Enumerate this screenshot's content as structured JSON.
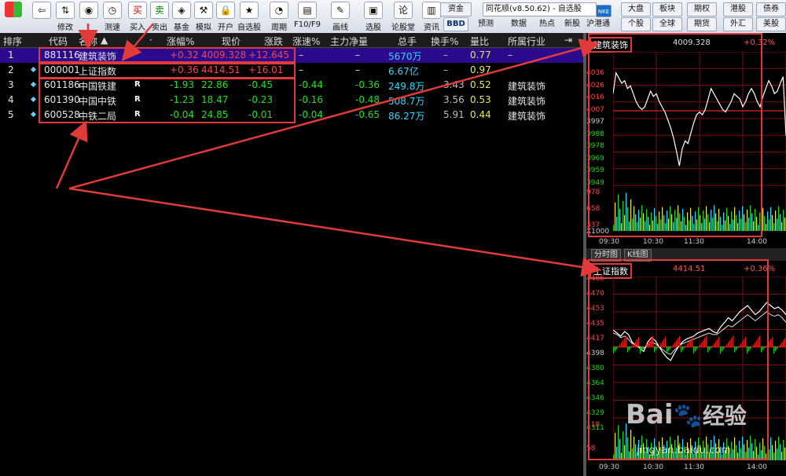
{
  "toolbar": {
    "buttons": [
      {
        "label": "",
        "icon": "grid-icon"
      },
      {
        "label": "",
        "icon": "back-arrow-icon"
      },
      {
        "label": "修改",
        "icon": "up-down-arrows-icon"
      },
      {
        "label": "",
        "icon": "coin-icon"
      },
      {
        "label": "测速",
        "icon": "clock-icon"
      },
      {
        "label": "买入",
        "icon": "buy-icon"
      },
      {
        "label": "卖出",
        "icon": "sell-icon"
      },
      {
        "label": "基金",
        "icon": "fund-icon"
      },
      {
        "label": "模拟",
        "icon": "hammer-icon"
      },
      {
        "label": "开户",
        "icon": "lock-icon"
      },
      {
        "label": "自选股",
        "icon": "star-icon"
      },
      {
        "label": "周期",
        "icon": "cycle-icon"
      },
      {
        "label": "F10/F9",
        "icon": "f10-icon"
      },
      {
        "label": "画线",
        "icon": "pen-icon"
      },
      {
        "label": "选股",
        "icon": "screen-icon"
      },
      {
        "label": "论股堂",
        "icon": "forum-icon"
      },
      {
        "label": "资讯",
        "icon": "news-icon"
      }
    ],
    "zijin": "资金",
    "bbd": "BBD",
    "app_title": "同花顺(v8.50.62) - 自选股",
    "nkb": "NKE",
    "sub_links": [
      "预测",
      "数据",
      "热点",
      "新股",
      "沪港通"
    ],
    "right_buttons": [
      [
        "大盘",
        "板块",
        "期权",
        "港股",
        "债券"
      ],
      [
        "个股",
        "全球",
        "期货",
        "外汇",
        "美股"
      ]
    ]
  },
  "table": {
    "headers": [
      "排序",
      "代码",
      "名称",
      "·",
      "涨幅%",
      "现价",
      "涨跌",
      "涨速%",
      "主力净量",
      "总手",
      "换手%",
      "量比",
      "所属行业"
    ],
    "sort_arrow": "▲",
    "rows": [
      {
        "rank": "1",
        "code": "881116",
        "name": "建筑装饰",
        "r": "",
        "pct": "+0.32",
        "price": "4009.328",
        "chg": "+12.645",
        "speed": "–",
        "net": "–",
        "vol": "5670万",
        "turn": "–",
        "ratio": "0.77",
        "ind": "–"
      },
      {
        "rank": "2",
        "code": "000001",
        "name": "上证指数",
        "r": "",
        "pct": "+0.36",
        "price": "4414.51",
        "chg": "+16.01",
        "speed": "–",
        "net": "–",
        "vol": "6.67亿",
        "turn": "–",
        "ratio": "0.97",
        "ind": ""
      },
      {
        "rank": "3",
        "code": "601186",
        "name": "中国铁建",
        "r": "R",
        "pct": "-1.93",
        "price": "22.86",
        "chg": "-0.45",
        "speed": "-0.44",
        "net": "-0.36",
        "vol": "249.8万",
        "turn": "3.43",
        "ratio": "0.52",
        "ind": "建筑装饰"
      },
      {
        "rank": "4",
        "code": "601390",
        "name": "中国中铁",
        "r": "R",
        "pct": "-1.23",
        "price": "18.47",
        "chg": "-0.23",
        "speed": "-0.16",
        "net": "-0.48",
        "vol": "508.7万",
        "turn": "3.56",
        "ratio": "0.53",
        "ind": "建筑装饰"
      },
      {
        "rank": "5",
        "code": "600528",
        "name": "中铁二局",
        "r": "R",
        "pct": "-0.04",
        "price": "24.85",
        "chg": "-0.01",
        "speed": "-0.04",
        "net": "-0.65",
        "vol": "86.27万",
        "turn": "5.91",
        "ratio": "0.44",
        "ind": "建筑装饰"
      }
    ]
  },
  "top_chart": {
    "name": "建筑装饰",
    "price": "4009.328",
    "pct": "+0.32%",
    "yaxis": [
      "4036",
      "4026",
      "4016",
      "4007",
      "3997",
      "3988",
      "3978",
      "3969",
      "3959",
      "3949"
    ],
    "vol_axis": [
      "978",
      "658",
      "337"
    ],
    "vol_unit": "X1000",
    "xaxis": [
      "09:30",
      "10:30",
      "11:30",
      "14:00"
    ],
    "series": [
      4010,
      4026,
      4022,
      4018,
      4020,
      4014,
      4016,
      4010,
      4004,
      4000,
      3998,
      4000,
      4006,
      4012,
      4008,
      4010,
      4004,
      4000,
      3996,
      3990,
      3984,
      3976,
      3966,
      3955,
      3968,
      3974,
      3972,
      3980,
      3988,
      3994,
      3996,
      3994,
      3998,
      4006,
      4014,
      4010,
      4006,
      4002,
      3998,
      3996,
      4000,
      4004,
      4010,
      4008,
      4006,
      4000,
      4004,
      4010,
      4014,
      4010,
      4004,
      4000,
      4008,
      4014,
      4020,
      4016,
      4010,
      4012,
      4018,
      4023,
      3978
    ]
  },
  "bottom_chart": {
    "tabs": [
      "分时图",
      "K线图"
    ],
    "name": "上证指数",
    "price": "4414.51",
    "pct": "+0.36%",
    "yaxis": [
      "4486",
      "4470",
      "4453",
      "4435",
      "4417",
      "4398",
      "4380",
      "4364",
      "4346",
      "4329",
      "4311"
    ],
    "vol_axis": [
      "118",
      "58"
    ],
    "xaxis": [
      "09:30",
      "10:30",
      "11:30",
      "14:00"
    ],
    "series": [
      4420,
      4416,
      4412,
      4418,
      4414,
      4404,
      4400,
      4396,
      4392,
      4404,
      4410,
      4406,
      4398,
      4390,
      4384,
      4380,
      4390,
      4398,
      4404,
      4408,
      4410,
      4412,
      4416,
      4418,
      4420,
      4422,
      4418,
      4416,
      4424,
      4430,
      4436,
      4432,
      4438,
      4444,
      4448,
      4452,
      4446,
      4440,
      4444,
      4450,
      4456,
      4452,
      4448,
      4450,
      4446,
      4440
    ],
    "series2": [
      4416,
      4414,
      4410,
      4412,
      4408,
      4402,
      4400,
      4398,
      4396,
      4400,
      4404,
      4402,
      4398,
      4394,
      4390,
      4388,
      4394,
      4398,
      4402,
      4404,
      4406,
      4408,
      4410,
      4412,
      4414,
      4416,
      4414,
      4414,
      4418,
      4422,
      4426,
      4424,
      4428,
      4432,
      4436,
      4440,
      4436,
      4432,
      4436,
      4440,
      4444,
      4440,
      4438,
      4440,
      4436,
      4430
    ]
  },
  "watermark": {
    "brand": "Bai",
    "brand2": "经验",
    "url": "jingyan.baidu.com"
  },
  "colors": {
    "up": "#ff4444",
    "down": "#22e022",
    "highlight": "#e03a3a",
    "selected": "#2c0a8c"
  }
}
